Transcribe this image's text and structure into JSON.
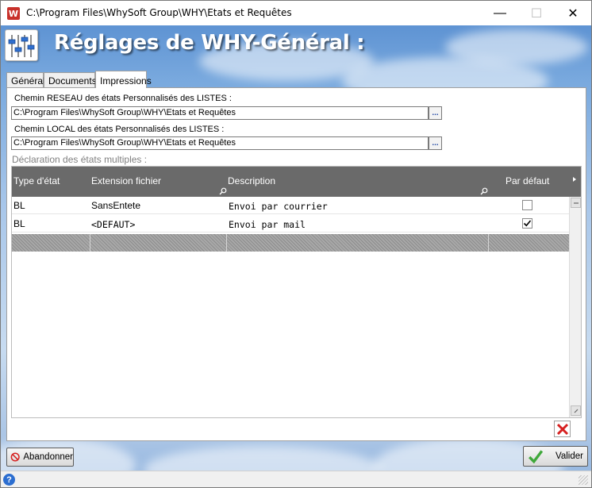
{
  "window": {
    "title": "C:\\Program Files\\WhySoft Group\\WHY\\Etats et Requêtes",
    "app_icon_text": "W",
    "minimize_symbol": "—",
    "maximize_symbol": "☐",
    "close_symbol": "✕"
  },
  "header": {
    "title": "Réglages de WHY-Général :",
    "icon": "sliders-icon"
  },
  "tabs": [
    {
      "label": "Général",
      "active": false
    },
    {
      "label": "Documents",
      "active": false
    },
    {
      "label": "Impressions",
      "active": true
    }
  ],
  "impressions": {
    "network_label": "Chemin RESEAU des états Personnalisés des LISTES :",
    "network_path": "C:\\Program Files\\WhySoft Group\\WHY\\Etats et Requêtes",
    "local_label": "Chemin LOCAL des états Personnalisés des LISTES :",
    "local_path": "C:\\Program Files\\WhySoft Group\\WHY\\Etats et Requêtes",
    "browse_label": "...",
    "section_label": "Déclaration des états multiples :"
  },
  "table": {
    "columns": [
      "Type d'état",
      "Extension fichier",
      "Description",
      "Par défaut"
    ],
    "rows": [
      {
        "type": "BL",
        "extension": "SansEntete",
        "description": "Envoi par courrier",
        "default": false
      },
      {
        "type": "BL",
        "extension": "<DEFAUT>",
        "description": "Envoi par mail",
        "default": true
      }
    ]
  },
  "buttons": {
    "cancel": "Abandonner",
    "validate": "Valider"
  },
  "status": {
    "help_symbol": "?"
  },
  "colors": {
    "header_gray": "#6a6a6a",
    "delete_red": "#d62020",
    "validate_green": "#3fa83a"
  }
}
